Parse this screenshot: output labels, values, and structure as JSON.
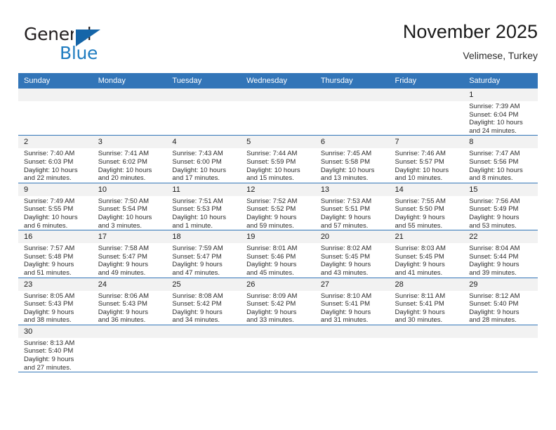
{
  "brand": {
    "name_part1": "General",
    "name_part2": "Blue",
    "logo_icon": "triangle-logo-icon"
  },
  "header": {
    "title": "November 2025",
    "subtitle": "Velimese, Turkey"
  },
  "calendar": {
    "weekday_headers": [
      "Sunday",
      "Monday",
      "Tuesday",
      "Wednesday",
      "Thursday",
      "Friday",
      "Saturday"
    ],
    "accent_color": "#3275b8",
    "daynum_bg": "#f2f2f2",
    "weeks": [
      [
        {
          "empty": true
        },
        {
          "empty": true
        },
        {
          "empty": true
        },
        {
          "empty": true
        },
        {
          "empty": true
        },
        {
          "empty": true
        },
        {
          "day": "1",
          "sunrise": "Sunrise: 7:39 AM",
          "sunset": "Sunset: 6:04 PM",
          "daylight1": "Daylight: 10 hours",
          "daylight2": "and 24 minutes."
        }
      ],
      [
        {
          "day": "2",
          "sunrise": "Sunrise: 7:40 AM",
          "sunset": "Sunset: 6:03 PM",
          "daylight1": "Daylight: 10 hours",
          "daylight2": "and 22 minutes."
        },
        {
          "day": "3",
          "sunrise": "Sunrise: 7:41 AM",
          "sunset": "Sunset: 6:02 PM",
          "daylight1": "Daylight: 10 hours",
          "daylight2": "and 20 minutes."
        },
        {
          "day": "4",
          "sunrise": "Sunrise: 7:43 AM",
          "sunset": "Sunset: 6:00 PM",
          "daylight1": "Daylight: 10 hours",
          "daylight2": "and 17 minutes."
        },
        {
          "day": "5",
          "sunrise": "Sunrise: 7:44 AM",
          "sunset": "Sunset: 5:59 PM",
          "daylight1": "Daylight: 10 hours",
          "daylight2": "and 15 minutes."
        },
        {
          "day": "6",
          "sunrise": "Sunrise: 7:45 AM",
          "sunset": "Sunset: 5:58 PM",
          "daylight1": "Daylight: 10 hours",
          "daylight2": "and 13 minutes."
        },
        {
          "day": "7",
          "sunrise": "Sunrise: 7:46 AM",
          "sunset": "Sunset: 5:57 PM",
          "daylight1": "Daylight: 10 hours",
          "daylight2": "and 10 minutes."
        },
        {
          "day": "8",
          "sunrise": "Sunrise: 7:47 AM",
          "sunset": "Sunset: 5:56 PM",
          "daylight1": "Daylight: 10 hours",
          "daylight2": "and 8 minutes."
        }
      ],
      [
        {
          "day": "9",
          "sunrise": "Sunrise: 7:49 AM",
          "sunset": "Sunset: 5:55 PM",
          "daylight1": "Daylight: 10 hours",
          "daylight2": "and 6 minutes."
        },
        {
          "day": "10",
          "sunrise": "Sunrise: 7:50 AM",
          "sunset": "Sunset: 5:54 PM",
          "daylight1": "Daylight: 10 hours",
          "daylight2": "and 3 minutes."
        },
        {
          "day": "11",
          "sunrise": "Sunrise: 7:51 AM",
          "sunset": "Sunset: 5:53 PM",
          "daylight1": "Daylight: 10 hours",
          "daylight2": "and 1 minute."
        },
        {
          "day": "12",
          "sunrise": "Sunrise: 7:52 AM",
          "sunset": "Sunset: 5:52 PM",
          "daylight1": "Daylight: 9 hours",
          "daylight2": "and 59 minutes."
        },
        {
          "day": "13",
          "sunrise": "Sunrise: 7:53 AM",
          "sunset": "Sunset: 5:51 PM",
          "daylight1": "Daylight: 9 hours",
          "daylight2": "and 57 minutes."
        },
        {
          "day": "14",
          "sunrise": "Sunrise: 7:55 AM",
          "sunset": "Sunset: 5:50 PM",
          "daylight1": "Daylight: 9 hours",
          "daylight2": "and 55 minutes."
        },
        {
          "day": "15",
          "sunrise": "Sunrise: 7:56 AM",
          "sunset": "Sunset: 5:49 PM",
          "daylight1": "Daylight: 9 hours",
          "daylight2": "and 53 minutes."
        }
      ],
      [
        {
          "day": "16",
          "sunrise": "Sunrise: 7:57 AM",
          "sunset": "Sunset: 5:48 PM",
          "daylight1": "Daylight: 9 hours",
          "daylight2": "and 51 minutes."
        },
        {
          "day": "17",
          "sunrise": "Sunrise: 7:58 AM",
          "sunset": "Sunset: 5:47 PM",
          "daylight1": "Daylight: 9 hours",
          "daylight2": "and 49 minutes."
        },
        {
          "day": "18",
          "sunrise": "Sunrise: 7:59 AM",
          "sunset": "Sunset: 5:47 PM",
          "daylight1": "Daylight: 9 hours",
          "daylight2": "and 47 minutes."
        },
        {
          "day": "19",
          "sunrise": "Sunrise: 8:01 AM",
          "sunset": "Sunset: 5:46 PM",
          "daylight1": "Daylight: 9 hours",
          "daylight2": "and 45 minutes."
        },
        {
          "day": "20",
          "sunrise": "Sunrise: 8:02 AM",
          "sunset": "Sunset: 5:45 PM",
          "daylight1": "Daylight: 9 hours",
          "daylight2": "and 43 minutes."
        },
        {
          "day": "21",
          "sunrise": "Sunrise: 8:03 AM",
          "sunset": "Sunset: 5:45 PM",
          "daylight1": "Daylight: 9 hours",
          "daylight2": "and 41 minutes."
        },
        {
          "day": "22",
          "sunrise": "Sunrise: 8:04 AM",
          "sunset": "Sunset: 5:44 PM",
          "daylight1": "Daylight: 9 hours",
          "daylight2": "and 39 minutes."
        }
      ],
      [
        {
          "day": "23",
          "sunrise": "Sunrise: 8:05 AM",
          "sunset": "Sunset: 5:43 PM",
          "daylight1": "Daylight: 9 hours",
          "daylight2": "and 38 minutes."
        },
        {
          "day": "24",
          "sunrise": "Sunrise: 8:06 AM",
          "sunset": "Sunset: 5:43 PM",
          "daylight1": "Daylight: 9 hours",
          "daylight2": "and 36 minutes."
        },
        {
          "day": "25",
          "sunrise": "Sunrise: 8:08 AM",
          "sunset": "Sunset: 5:42 PM",
          "daylight1": "Daylight: 9 hours",
          "daylight2": "and 34 minutes."
        },
        {
          "day": "26",
          "sunrise": "Sunrise: 8:09 AM",
          "sunset": "Sunset: 5:42 PM",
          "daylight1": "Daylight: 9 hours",
          "daylight2": "and 33 minutes."
        },
        {
          "day": "27",
          "sunrise": "Sunrise: 8:10 AM",
          "sunset": "Sunset: 5:41 PM",
          "daylight1": "Daylight: 9 hours",
          "daylight2": "and 31 minutes."
        },
        {
          "day": "28",
          "sunrise": "Sunrise: 8:11 AM",
          "sunset": "Sunset: 5:41 PM",
          "daylight1": "Daylight: 9 hours",
          "daylight2": "and 30 minutes."
        },
        {
          "day": "29",
          "sunrise": "Sunrise: 8:12 AM",
          "sunset": "Sunset: 5:40 PM",
          "daylight1": "Daylight: 9 hours",
          "daylight2": "and 28 minutes."
        }
      ],
      [
        {
          "day": "30",
          "sunrise": "Sunrise: 8:13 AM",
          "sunset": "Sunset: 5:40 PM",
          "daylight1": "Daylight: 9 hours",
          "daylight2": "and 27 minutes."
        },
        {
          "empty": true
        },
        {
          "empty": true
        },
        {
          "empty": true
        },
        {
          "empty": true
        },
        {
          "empty": true
        },
        {
          "empty": true
        }
      ]
    ]
  }
}
